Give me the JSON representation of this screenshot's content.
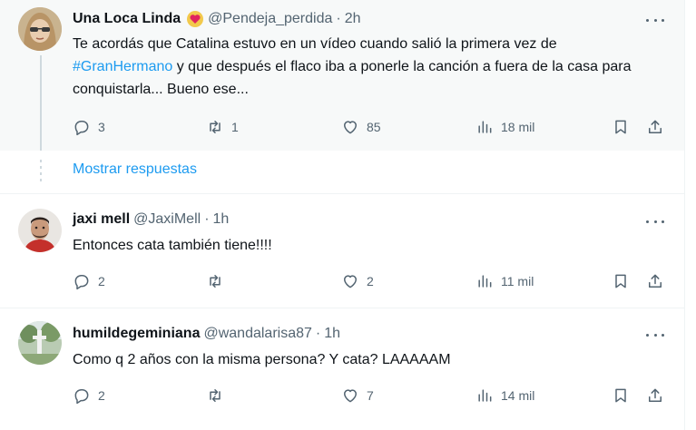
{
  "tweets": [
    {
      "name": "Una Loca Linda",
      "handle": "@Pendeja_perdida",
      "separator": "·",
      "time": "2h",
      "text_before": "Te acordás que Catalina estuvo en un vídeo cuando salió la primera vez de",
      "hashtag": "#GranHermano",
      "text_after": " y que después el flaco iba a ponerle la canción a fuera de la casa para conquistarla... Bueno ese...",
      "replies": "3",
      "retweets": "1",
      "likes": "85",
      "views": "18 mil"
    },
    {
      "name": "jaxi mell",
      "handle": "@JaxiMell",
      "separator": "·",
      "time": "1h",
      "text": "Entonces cata también tiene!!!!",
      "replies": "2",
      "retweets": "",
      "likes": "2",
      "views": "11 mil"
    },
    {
      "name": "humildegeminiana",
      "handle": "@wandalarisa87",
      "separator": "·",
      "time": "1h",
      "text": "Como q 2 años con la misma persona? Y cata? LAAAAAM",
      "replies": "2",
      "retweets": "",
      "likes": "7",
      "views": "14 mil"
    }
  ],
  "show_replies": "Mostrar respuestas",
  "colors": {
    "accent": "#1d9bf0",
    "muted": "#536471",
    "text": "#0f1419",
    "badge": "#e0245e"
  },
  "icons": [
    "reply-icon",
    "retweet-icon",
    "like-icon",
    "views-icon",
    "bookmark-icon",
    "share-icon",
    "more-icon",
    "heart-badge-icon"
  ]
}
